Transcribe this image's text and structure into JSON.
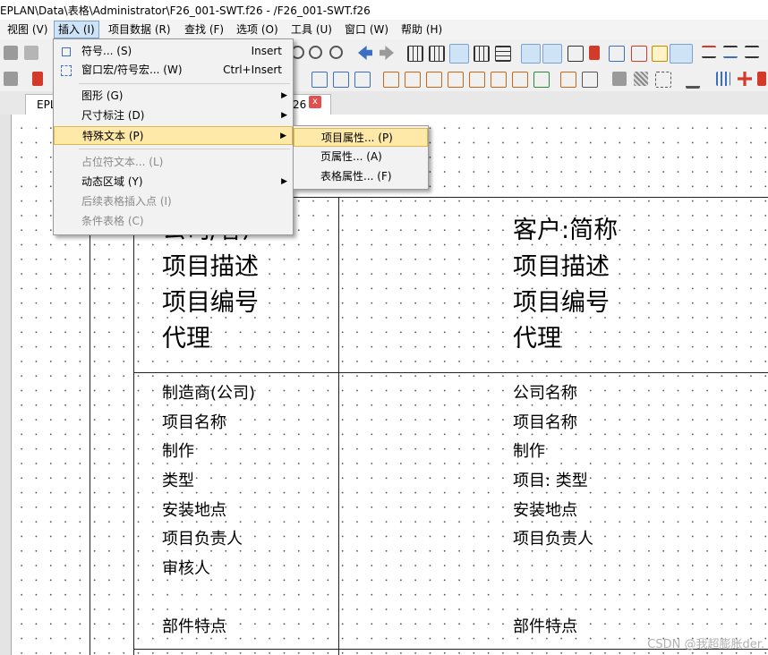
{
  "window": {
    "title": "EPLAN\\Data\\表格\\Administrator\\F26_001-SWT.f26 - /F26_001-SWT.f26"
  },
  "menubar": {
    "items": [
      {
        "label": "视图 (V)"
      },
      {
        "label": "插入 (I)"
      },
      {
        "label": "项目数据 (R)"
      },
      {
        "label": "查找 (F)"
      },
      {
        "label": "选项 (O)"
      },
      {
        "label": "工具 (U)"
      },
      {
        "label": "窗口 (W)"
      },
      {
        "label": "帮助 (H)"
      }
    ],
    "active": "插入 (I)"
  },
  "tabs": {
    "left_tab": "EPL",
    "right_tab_suffix": "26",
    "close_glyph": "x"
  },
  "insert_menu": {
    "symbol": {
      "label": "符号... (S)",
      "shortcut": "Insert"
    },
    "window_macro": {
      "label": "窗口宏/符号宏... (W)",
      "shortcut": "Ctrl+Insert"
    },
    "graphics": {
      "label": "图形 (G)"
    },
    "dimension": {
      "label": "尺寸标注 (D)"
    },
    "special_text": {
      "label": "特殊文本 (P)"
    },
    "placeholder_text": {
      "label": "占位符文本... (L)"
    },
    "dynamic_area": {
      "label": "动态区域 (Y)"
    },
    "subsequent_insert": {
      "label": "后续表格插入点 (I)"
    },
    "conditional_form": {
      "label": "条件表格 (C)"
    },
    "submenu_arrow": "▶"
  },
  "special_text_submenu": {
    "items": [
      {
        "label": "项目属性... (P)"
      },
      {
        "label": "页属性... (A)"
      },
      {
        "label": "表格属性... (F)"
      }
    ]
  },
  "form": {
    "left_big": [
      "公司/客户",
      "项目描述",
      "项目编号",
      "代理"
    ],
    "right_big": [
      "客户:简称",
      "项目描述",
      "项目编号",
      "代理"
    ],
    "left_small": [
      "制造商(公司)",
      "项目名称",
      "制作",
      "类型",
      "安装地点",
      "项目负责人",
      "审核人",
      "",
      "部件特点"
    ],
    "right_small": [
      "公司名称",
      "项目名称",
      "制作",
      "项目: 类型",
      "安装地点",
      "项目负责人",
      "",
      "",
      "部件特点"
    ]
  },
  "watermark": "CSDN @我超膨胀der.",
  "colors": {
    "menu_highlight": "#ffe9a8",
    "menu_active": "#cfe3f7",
    "tab_close": "#e05050"
  }
}
